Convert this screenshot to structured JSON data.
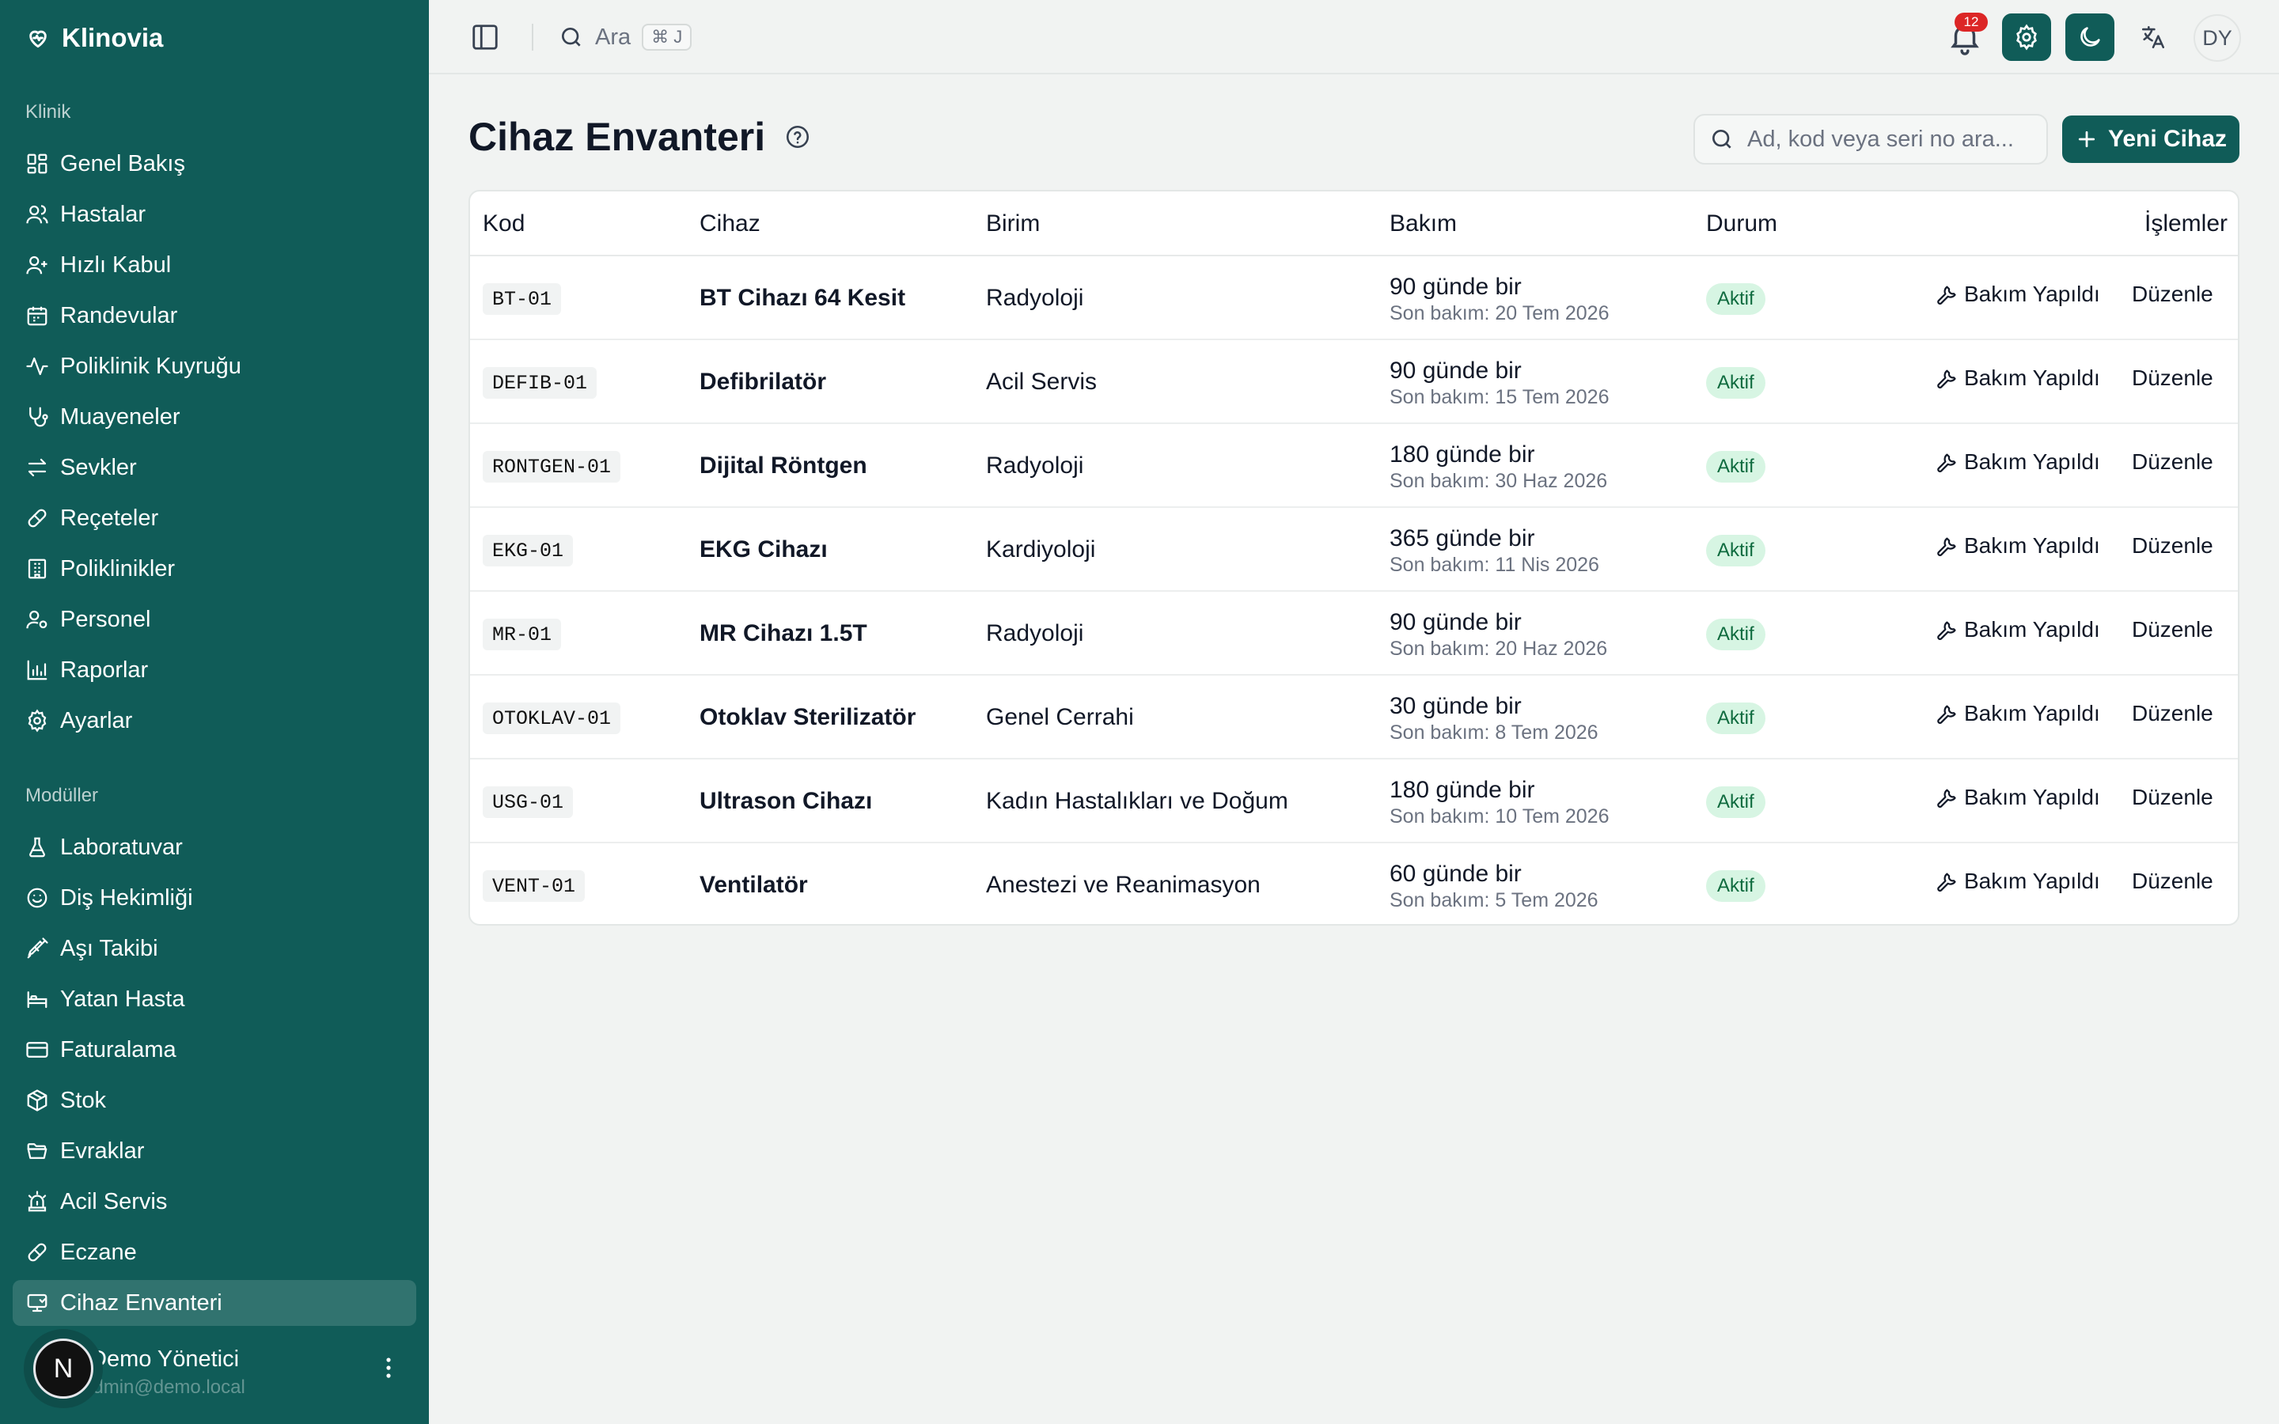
{
  "app": {
    "name": "Klinovia"
  },
  "sidebar": {
    "sections": [
      {
        "label": "Klinik",
        "items": [
          {
            "label": "Genel Bakış",
            "icon": "dashboard-icon"
          },
          {
            "label": "Hastalar",
            "icon": "users-icon"
          },
          {
            "label": "Hızlı Kabul",
            "icon": "user-plus-icon"
          },
          {
            "label": "Randevular",
            "icon": "calendar-icon"
          },
          {
            "label": "Poliklinik Kuyruğu",
            "icon": "activity-icon"
          },
          {
            "label": "Muayeneler",
            "icon": "stethoscope-icon"
          },
          {
            "label": "Sevkler",
            "icon": "arrows-swap-icon"
          },
          {
            "label": "Reçeteler",
            "icon": "pill-icon"
          },
          {
            "label": "Poliklinikler",
            "icon": "building-icon"
          },
          {
            "label": "Personel",
            "icon": "user-cog-icon"
          },
          {
            "label": "Raporlar",
            "icon": "bar-chart-icon"
          },
          {
            "label": "Ayarlar",
            "icon": "gear-icon"
          }
        ]
      },
      {
        "label": "Modüller",
        "items": [
          {
            "label": "Laboratuvar",
            "icon": "flask-icon"
          },
          {
            "label": "Diş Hekimliği",
            "icon": "smile-icon"
          },
          {
            "label": "Aşı Takibi",
            "icon": "syringe-icon"
          },
          {
            "label": "Yatan Hasta",
            "icon": "bed-icon"
          },
          {
            "label": "Faturalama",
            "icon": "credit-card-icon"
          },
          {
            "label": "Stok",
            "icon": "package-icon"
          },
          {
            "label": "Evraklar",
            "icon": "folder-icon"
          },
          {
            "label": "Acil Servis",
            "icon": "siren-icon"
          },
          {
            "label": "Eczane",
            "icon": "pill-icon"
          },
          {
            "label": "Cihaz Envanteri",
            "icon": "monitor-icon",
            "active": true
          }
        ]
      }
    ],
    "user": {
      "avatar_letter": "N",
      "name": "Demo Yönetici",
      "email": "admin@demo.local"
    }
  },
  "topbar": {
    "search_label": "Ara",
    "search_shortcut": "⌘ J",
    "notification_count": "12",
    "user_initials": "DY"
  },
  "page": {
    "title": "Cihaz Envanteri",
    "search_placeholder": "Ad, kod veya seri no ara...",
    "new_button": "Yeni Cihaz"
  },
  "table": {
    "columns": [
      "Kod",
      "Cihaz",
      "Birim",
      "Bakım",
      "Durum",
      "İşlemler"
    ],
    "action_maintenance": "Bakım Yapıldı",
    "action_edit": "Düzenle",
    "rows": [
      {
        "code": "BT-01",
        "device": "BT Cihazı 64 Kesit",
        "unit": "Radyoloji",
        "interval": "90 günde bir",
        "last": "Son bakım: 20 Tem 2026",
        "status": "Aktif"
      },
      {
        "code": "DEFIB-01",
        "device": "Defibrilatör",
        "unit": "Acil Servis",
        "interval": "90 günde bir",
        "last": "Son bakım: 15 Tem 2026",
        "status": "Aktif"
      },
      {
        "code": "RONTGEN-01",
        "device": "Dijital Röntgen",
        "unit": "Radyoloji",
        "interval": "180 günde bir",
        "last": "Son bakım: 30 Haz 2026",
        "status": "Aktif"
      },
      {
        "code": "EKG-01",
        "device": "EKG Cihazı",
        "unit": "Kardiyoloji",
        "interval": "365 günde bir",
        "last": "Son bakım: 11 Nis 2026",
        "status": "Aktif"
      },
      {
        "code": "MR-01",
        "device": "MR Cihazı 1.5T",
        "unit": "Radyoloji",
        "interval": "90 günde bir",
        "last": "Son bakım: 20 Haz 2026",
        "status": "Aktif"
      },
      {
        "code": "OTOKLAV-01",
        "device": "Otoklav Sterilizatör",
        "unit": "Genel Cerrahi",
        "interval": "30 günde bir",
        "last": "Son bakım: 8 Tem 2026",
        "status": "Aktif"
      },
      {
        "code": "USG-01",
        "device": "Ultrason Cihazı",
        "unit": "Kadın Hastalıkları ve Doğum",
        "interval": "180 günde bir",
        "last": "Son bakım: 10 Tem 2026",
        "status": "Aktif"
      },
      {
        "code": "VENT-01",
        "device": "Ventilatör",
        "unit": "Anestezi ve Reanimasyon",
        "interval": "60 günde bir",
        "last": "Son bakım: 5 Tem 2026",
        "status": "Aktif"
      }
    ]
  },
  "colors": {
    "brand": "#105c58",
    "status_bg": "#d7f5e3",
    "status_text": "#0f6b3f",
    "badge": "#dc2626"
  }
}
